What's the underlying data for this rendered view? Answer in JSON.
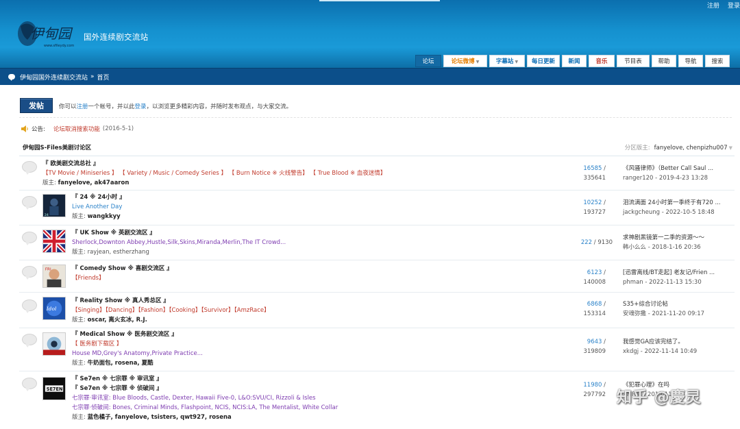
{
  "header": {
    "site_name": "国外连续剧交流站",
    "logo_text": "伊甸园",
    "logo_url_text": "www.sfileydy.com",
    "top_links": [
      "注册",
      "登录"
    ]
  },
  "nav": [
    {
      "label": "论坛",
      "active": true,
      "color": ""
    },
    {
      "label": "论坛微博",
      "color": "#e67e00",
      "dropdown": true
    },
    {
      "label": "字幕站",
      "color": "#0a6db5",
      "dropdown": true
    },
    {
      "label": "每日更新",
      "color": "#0a6db5"
    },
    {
      "label": "新闻",
      "color": "#0a6db5"
    },
    {
      "label": "音乐",
      "color": "#c0392b"
    },
    {
      "label": "节目表",
      "color": "#333"
    },
    {
      "label": "帮助",
      "color": "#333"
    },
    {
      "label": "导航",
      "color": "#333"
    },
    {
      "label": "搜索",
      "color": "#333"
    }
  ],
  "breadcrumb": {
    "items": [
      "伊甸园国外连续剧交流站",
      "首页"
    ],
    "separator": "»"
  },
  "post_button": "发帖",
  "login_tip": {
    "before": "你可以",
    "register": "注册",
    "mid": "一个帐号，并以此",
    "login": "登录",
    "after": "，以浏览更多精彩内容，并随时发布观点，与大家交流。"
  },
  "announcement": {
    "label": "公告:",
    "title": "论坛取消搜索功能",
    "date": "(2016-5-1)"
  },
  "category": {
    "name": "伊甸园S-Files美剧讨论区",
    "mods_label": "分区版主:",
    "mods": "fanyelove,  chenpizhu007"
  },
  "forums": [
    {
      "title": "『 欧美剧交流总社 』",
      "tags": "【TV Movie / Miniseries 】 【 Variety / Music / Comedy Series 】 【 Burn Notice ※ 火线警告】 【 True Blood ※ 血夜迷情】",
      "mods_label": "版主:",
      "mods": "fanyelove, ak47aaron",
      "topics": "16585",
      "posts": "335641",
      "last_title": "《风骚律师》（Better Call Saul ...",
      "last_meta": "ranger120 - 2019-4-23 13:28"
    },
    {
      "title": "『 24 ※ 24小时 』",
      "desc": "Live Another Day",
      "mods_label": "版主:",
      "mods": "wangkkyy",
      "topics": "10252",
      "posts": "193727",
      "last_title": "泪流满面 24小时第一季终于有720 ...",
      "last_meta": "jackgcheung - 2022-10-5 18:48"
    },
    {
      "title": "『 UK Show ※ 英剧交流区 』",
      "desc": "Sherlock,Downton Abbey,Hustle,Silk,Skins,Miranda,Merlin,The IT Crowd...",
      "mods_label": "版主:",
      "mods": "rayjean, estherzhang",
      "topics": "222",
      "posts": "9130",
      "last_title": "求神剧黑镜第一二季的资源～～",
      "last_meta": "韩小么么 - 2018-1-16 20:36"
    },
    {
      "title": "『 Comedy Show ※ 喜剧交流区 』",
      "tags": "【Friends】",
      "topics": "6123",
      "posts": "140008",
      "last_title": "[迅雷离线/BT走起] 老友记/Frien ...",
      "last_meta": "phman - 2022-11-13 15:30"
    },
    {
      "title": "『 Reality Show ※ 真人秀总区 』",
      "tags": "【Singing】【Dancing】【Fashion】【Cooking】【Survivor】【AmzRace】",
      "mods_label": "版主:",
      "mods": "oscar, 离火玄冰, R.J.",
      "topics": "6868",
      "posts": "153314",
      "last_title": "S35+综合讨论帖",
      "last_meta": "安魂弥撒 - 2021-11-20 09:17"
    },
    {
      "title": "『 Medical Show ※ 医务剧交流区 』",
      "sub": "【 医务剧下载区 】",
      "desc": "House MD,Grey's Anatomy,Private Practice...",
      "mods_label": "版主:",
      "mods": "牛奶面包, rosena, 夏酷",
      "topics": "9643",
      "posts": "319809",
      "last_title": "我感觉GA应该完结了。",
      "last_meta": "xkdgj - 2022-11-14 10:49"
    },
    {
      "title": "『 Se7en ※ 七宗罪 ※ 审讯室 』",
      "title2": "『 Se7en ※ 七宗罪 ※ 侦破间 』",
      "desc": "七宗罪·审讯室:  Blue Bloods, Castle, Dexter, Hawaii Five-0, L&O:SVU/CI, Rizzoli & Isles",
      "desc2": "七宗罪·侦破间:  Bones, Criminal Minds, Flashpoint, NCIS, NCIS:LA, The Mentalist, White Collar",
      "mods_label": "版主:",
      "mods": "蓝色橘子, fanyelove, tsisters, qwt927, rosena",
      "topics": "11980",
      "posts": "297792",
      "last_title": "《犯罪心理》在吗",
      "last_meta": "XMR原 - 2019-11"
    }
  ],
  "watermark": "知乎 @慶灵",
  "colors": {
    "header": "#1591cf",
    "crumbbar": "#0c4f8a",
    "link": "#2a82c9",
    "tag_red": "#c0392b",
    "desc_purple": "#7d3bb0"
  }
}
